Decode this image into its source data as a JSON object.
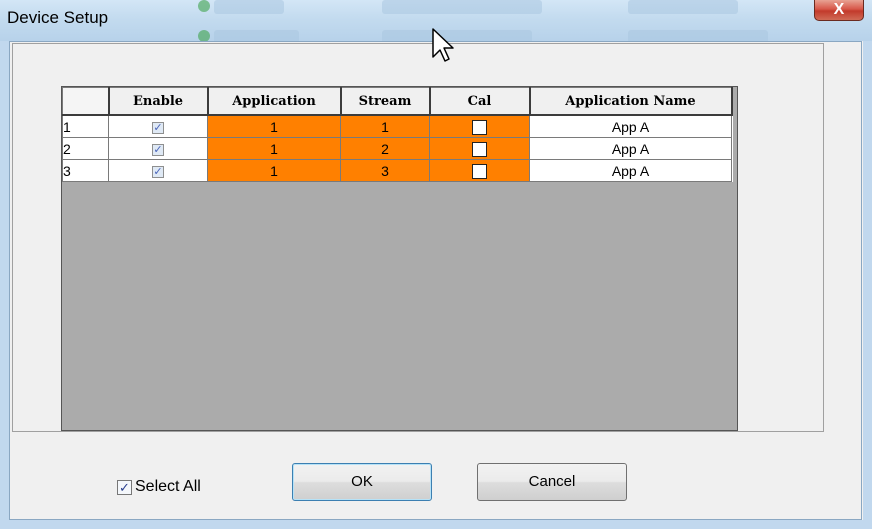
{
  "window": {
    "title": "Device Setup",
    "close_glyph": "X"
  },
  "grid": {
    "columns": [
      "",
      "Enable",
      "Application",
      "Stream",
      "Cal",
      "Application Name"
    ],
    "rows": [
      {
        "num": "1",
        "enable": true,
        "application": "1",
        "stream": "1",
        "cal": false,
        "app_name": "App A"
      },
      {
        "num": "2",
        "enable": true,
        "application": "1",
        "stream": "2",
        "cal": false,
        "app_name": "App A"
      },
      {
        "num": "3",
        "enable": true,
        "application": "1",
        "stream": "3",
        "cal": false,
        "app_name": "App A"
      }
    ],
    "highlight_color": "#ff8000"
  },
  "footer": {
    "select_all_label": "Select All",
    "select_all_checked": true,
    "ok_label": "OK",
    "cancel_label": "Cancel"
  },
  "icons": {
    "check": "check-icon",
    "close": "close-icon",
    "cursor": "mouse-pointer-icon"
  }
}
